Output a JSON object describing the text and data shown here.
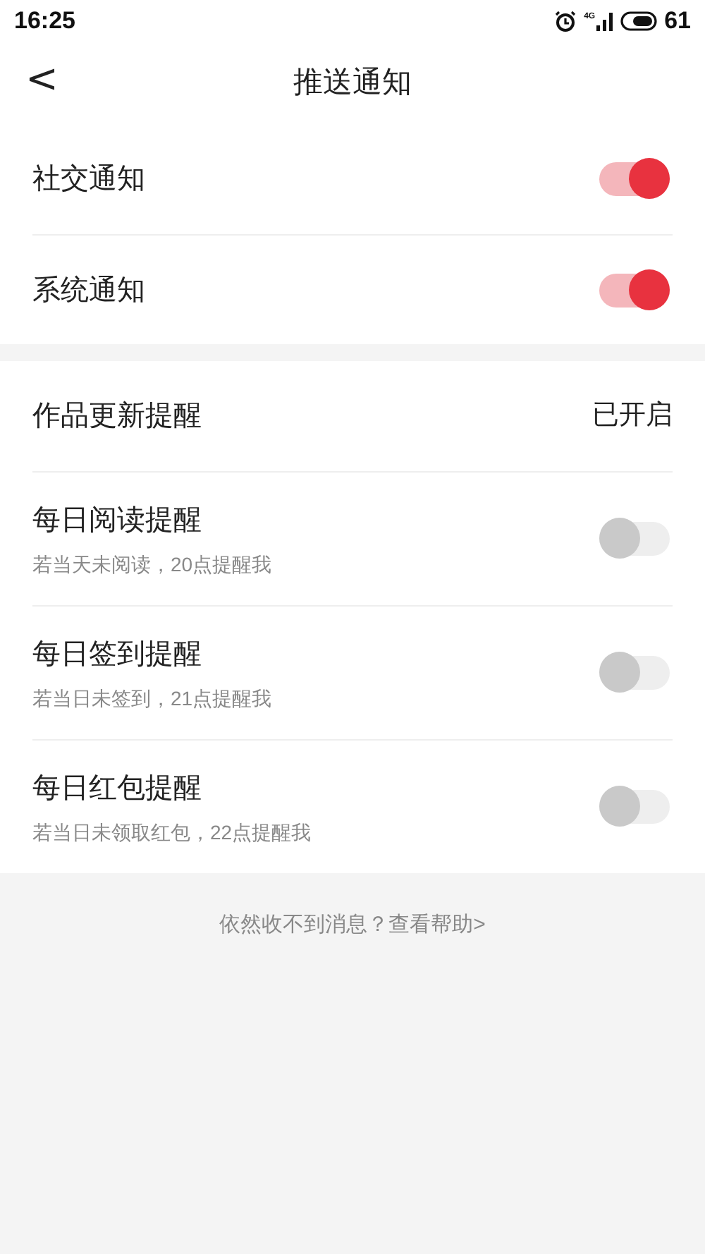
{
  "status_bar": {
    "time": "16:25",
    "network": "4G",
    "battery": "61"
  },
  "header": {
    "back": "<",
    "title": "推送通知"
  },
  "sections": [
    {
      "items": [
        {
          "kind": "toggle",
          "title": "社交通知",
          "on": true
        },
        {
          "kind": "toggle",
          "title": "系统通知",
          "on": true
        }
      ]
    },
    {
      "items": [
        {
          "kind": "value",
          "title": "作品更新提醒",
          "value": "已开启"
        },
        {
          "kind": "toggle",
          "title": "每日阅读提醒",
          "subtitle": "若当天未阅读，20点提醒我",
          "on": false
        },
        {
          "kind": "toggle",
          "title": "每日签到提醒",
          "subtitle": "若当日未签到，21点提醒我",
          "on": false
        },
        {
          "kind": "toggle",
          "title": "每日红包提醒",
          "subtitle": "若当日未领取红包，22点提醒我",
          "on": false
        }
      ]
    }
  ],
  "help_link": "依然收不到消息？查看帮助>"
}
